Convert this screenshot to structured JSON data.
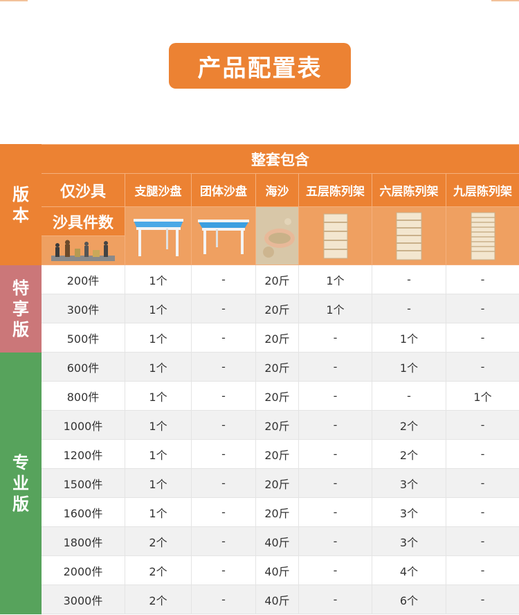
{
  "page_title": "产品配置表",
  "header": {
    "version_label": [
      "版",
      "本"
    ],
    "package_label": "整套包含",
    "sand_tools_only": "仅沙具",
    "tool_count_label": "沙具件数",
    "columns": [
      "支腿沙盘",
      "团体沙盘",
      "海沙",
      "五层陈列架",
      "六层陈列架",
      "九层陈列架"
    ]
  },
  "groups": [
    {
      "name_chars": [
        "特",
        "享",
        "版"
      ],
      "color": "#cb7779",
      "rows": [
        [
          "200件",
          "1个",
          "-",
          "20斤",
          "1个",
          "-",
          "-"
        ],
        [
          "300件",
          "1个",
          "-",
          "20斤",
          "1个",
          "-",
          "-"
        ],
        [
          "500件",
          "1个",
          "-",
          "20斤",
          "-",
          "1个",
          "-"
        ]
      ]
    },
    {
      "name_chars": [
        "专",
        "业",
        "版"
      ],
      "color": "#57a35c",
      "rows": [
        [
          "600件",
          "1个",
          "-",
          "20斤",
          "-",
          "1个",
          "-"
        ],
        [
          "800件",
          "1个",
          "-",
          "20斤",
          "-",
          "-",
          "1个"
        ],
        [
          "1000件",
          "1个",
          "-",
          "20斤",
          "-",
          "2个",
          "-"
        ],
        [
          "1200件",
          "1个",
          "-",
          "20斤",
          "-",
          "2个",
          "-"
        ],
        [
          "1500件",
          "1个",
          "-",
          "20斤",
          "-",
          "3个",
          "-"
        ],
        [
          "1600件",
          "1个",
          "-",
          "20斤",
          "-",
          "3个",
          "-"
        ],
        [
          "1800件",
          "2个",
          "-",
          "40斤",
          "-",
          "3个",
          "-"
        ],
        [
          "2000件",
          "2个",
          "-",
          "40斤",
          "-",
          "4个",
          "-"
        ],
        [
          "3000件",
          "2个",
          "-",
          "40斤",
          "-",
          "6个",
          "-"
        ]
      ]
    }
  ],
  "colors": {
    "accent": "#ec8233",
    "accent_light": "#efa061",
    "special": "#cb7779",
    "pro": "#57a35c"
  },
  "icons": [
    "sand-tools-figurines-image",
    "legged-sand-tray-image",
    "group-sand-tray-image",
    "sea-sand-image",
    "five-tier-shelf-image",
    "six-tier-shelf-image",
    "nine-tier-shelf-image"
  ]
}
